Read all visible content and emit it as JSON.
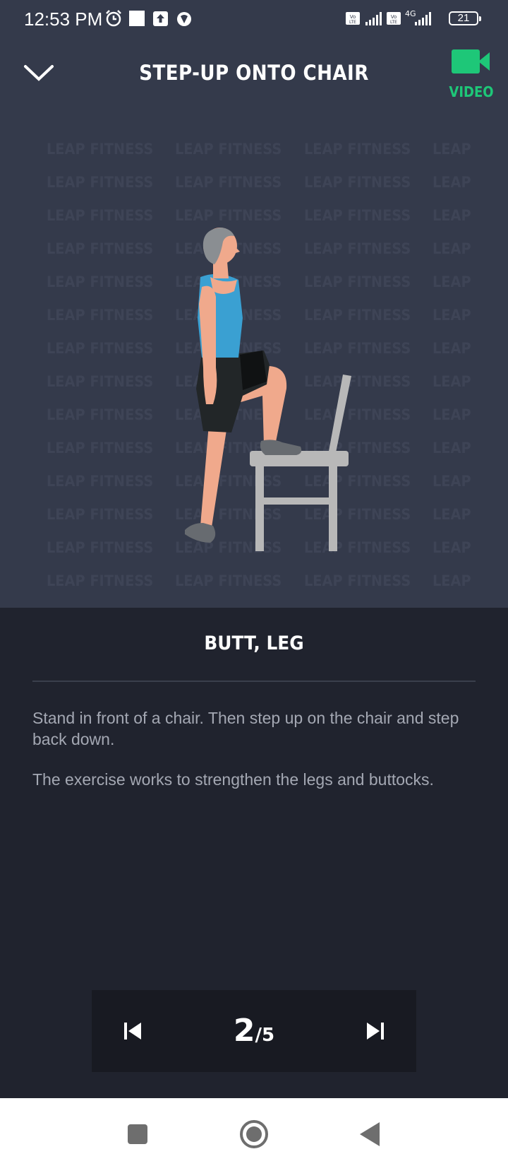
{
  "status_bar": {
    "time": "12:53 PM",
    "battery": "21",
    "network": "4G"
  },
  "header": {
    "title": "STEP-UP ONTO CHAIR",
    "video_label": "VIDEO",
    "accent_color": "#1ec778"
  },
  "watermark": {
    "text": "LEAP FITNESS"
  },
  "exercise": {
    "muscles": "BUTT, LEG",
    "description_1": "Stand in front of a chair. Then step up on the chair and step back down.",
    "description_2": "The exercise works to strengthen the legs and buttocks."
  },
  "pager": {
    "current": "2",
    "total": "/5"
  },
  "icons": {
    "back": "chevron-down-icon",
    "video": "video-camera-icon",
    "prev": "skip-previous-icon",
    "next": "skip-next-icon",
    "recents": "square-icon",
    "home": "circle-icon",
    "system_back": "triangle-back-icon"
  }
}
